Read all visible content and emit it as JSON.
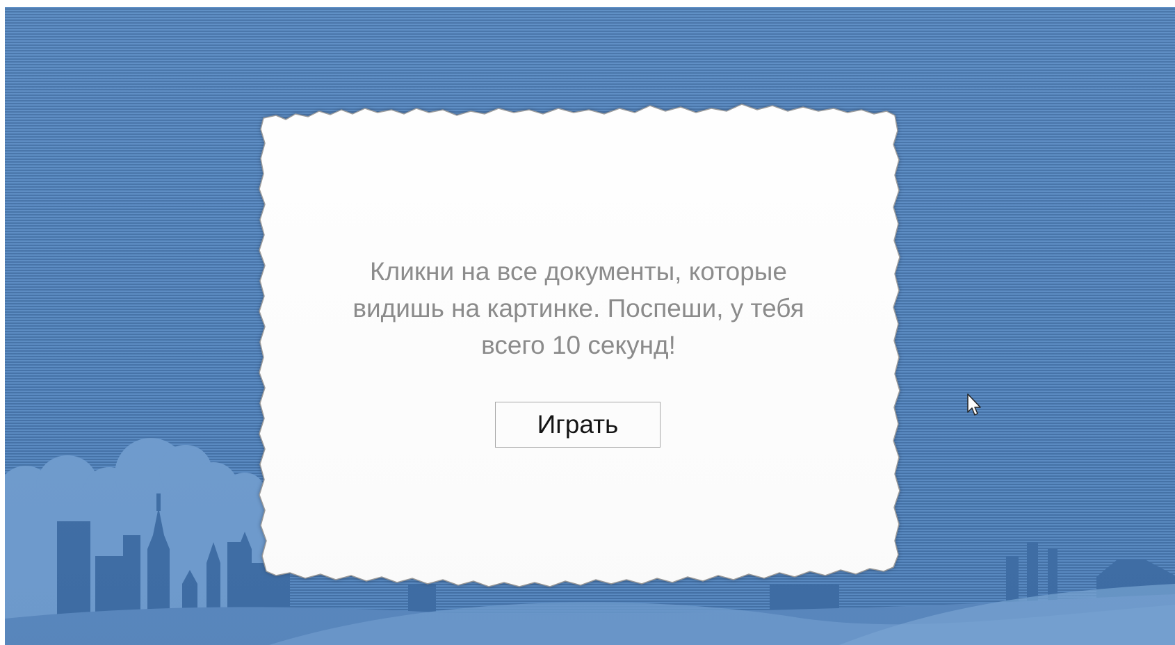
{
  "dialog": {
    "instructions": "Кликни на все документы, которые видишь на картинке. Поспеши, у тебя всего 10 секунд!",
    "play_button_label": "Играть"
  },
  "background": {
    "colors": {
      "stripe_light": "#5a8bc3",
      "stripe_dark": "#4472a8",
      "silhouette": "#6f9ccf",
      "silhouette_dark": "#3f6ea6",
      "paper": "#ffffff",
      "paper_edge": "#8a8a8a"
    },
    "scene": "city-silhouette-with-fields"
  },
  "cursor": {
    "icon": "mouse-pointer-icon"
  }
}
